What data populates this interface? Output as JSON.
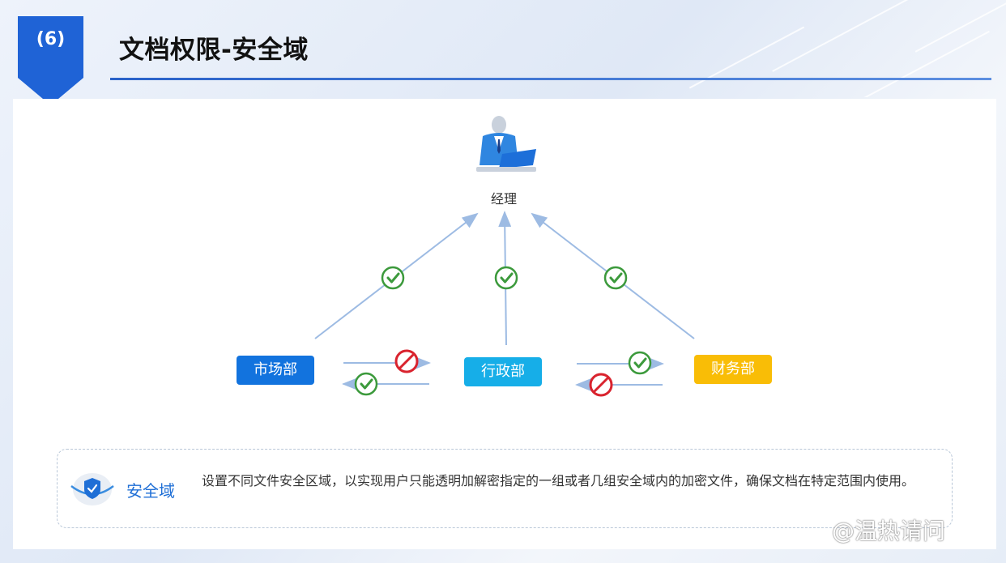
{
  "header": {
    "section_number": "(6)",
    "title": "文档权限-安全域"
  },
  "diagram": {
    "top_node": {
      "label": "经理",
      "icon": "manager-at-laptop-icon"
    },
    "departments": [
      {
        "id": "market",
        "label": "市场部",
        "color": "#1273de"
      },
      {
        "id": "admin",
        "label": "行政部",
        "color": "#16aee8"
      },
      {
        "id": "finance",
        "label": "财务部",
        "color": "#f9bd06"
      }
    ],
    "access": [
      {
        "from": "市场部",
        "to": "经理",
        "status": "allowed"
      },
      {
        "from": "行政部",
        "to": "经理",
        "status": "allowed"
      },
      {
        "from": "财务部",
        "to": "经理",
        "status": "allowed"
      },
      {
        "from": "市场部",
        "to": "行政部",
        "status": "denied"
      },
      {
        "from": "行政部",
        "to": "市场部",
        "status": "allowed"
      },
      {
        "from": "行政部",
        "to": "财务部",
        "status": "allowed"
      },
      {
        "from": "财务部",
        "to": "行政部",
        "status": "denied"
      }
    ],
    "colors": {
      "allowed": "#3c9a3c",
      "denied": "#d9232e",
      "arrow": "#9dbbe3"
    }
  },
  "info": {
    "label": "安全域",
    "description": "设置不同文件安全区域，以实现用户只能透明加解密指定的一组或者几组安全域内的加密文件，确保文档在特定范围内使用。"
  },
  "watermark": "@温热请问"
}
